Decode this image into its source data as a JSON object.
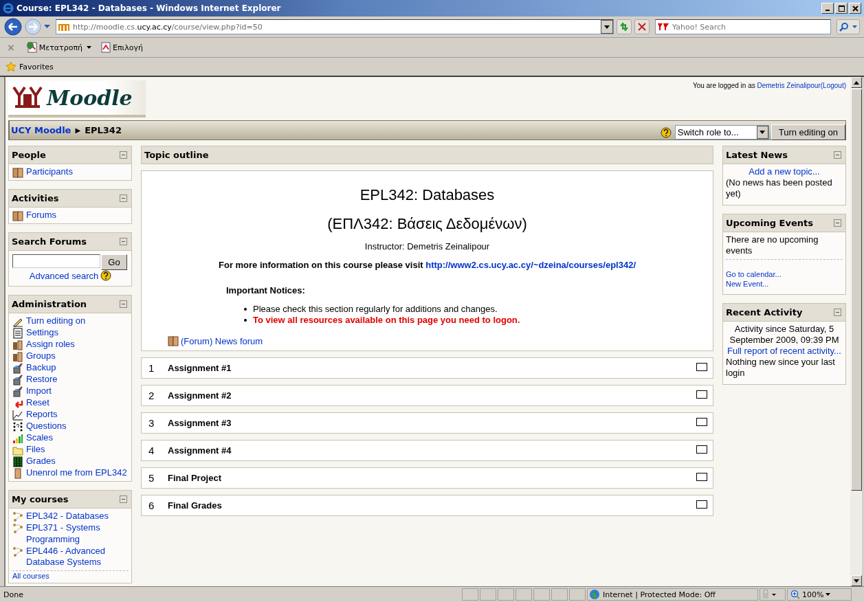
{
  "window": {
    "title": "Course: EPL342 - Databases - Windows Internet Explorer"
  },
  "address_bar": {
    "url_prefix": "http://moodle.cs.",
    "url_domain": "ucy.ac.cy",
    "url_path": "/course/view.php?id=50",
    "search_placeholder": "Yahoo! Search"
  },
  "command_bar": {
    "close": "×",
    "items": [
      "Μετατροπή",
      "Επιλογή"
    ]
  },
  "favorites": {
    "label": "Favorites"
  },
  "header": {
    "logo": "Moodle",
    "login_prefix": "You are logged in as",
    "user": "Demetris Zeinalipour",
    "logout": "(Logout)"
  },
  "breadcrumb": {
    "items": [
      "UCY Moodle",
      "EPL342"
    ],
    "separator": "▶"
  },
  "role_select": {
    "value": "Switch role to..."
  },
  "edit_button": {
    "label": "Turn editing on"
  },
  "left_blocks": [
    {
      "title": "People",
      "kind": "links",
      "items": [
        "Participants"
      ]
    },
    {
      "title": "Activities",
      "kind": "links",
      "items": [
        "Forums"
      ]
    },
    {
      "title": "Search Forums",
      "kind": "search",
      "button": "Go",
      "link": "Advanced search"
    },
    {
      "title": "Administration",
      "kind": "admin",
      "items": [
        "Turn editing on",
        "Settings",
        "Assign roles",
        "Groups",
        "Backup",
        "Restore",
        "Import",
        "Reset",
        "Reports",
        "Questions",
        "Scales",
        "Files",
        "Grades",
        "Unenrol me from EPL342"
      ]
    },
    {
      "title": "My courses",
      "kind": "courses",
      "items": [
        "EPL342 - Databases",
        "EPL371 - Systems Programming",
        "EPL446 - Advanced Database Systems"
      ],
      "footer": "All courses"
    }
  ],
  "topic_outline": {
    "title": "Topic outline",
    "course_title": "EPL342: Databases",
    "course_subtitle": "(ΕΠΛ342: Βάσεις Δεδομένων)",
    "instructor": "Instructor: Demetris Zeinalipour",
    "info": "For more information on this course please visit",
    "info_link": "http://www2.cs.ucy.ac.cy/~dzeina/courses/epl342/",
    "notices_title": "Important Notices:",
    "notices": [
      {
        "text": "Please check this section regularly for additions and changes.",
        "kind": "normal"
      },
      {
        "text": "To view all resources available on this page you need to logon.",
        "kind": "alert"
      }
    ],
    "forum": "(Forum) News forum",
    "sections": [
      {
        "number": "1",
        "title": "Assignment #1"
      },
      {
        "number": "2",
        "title": "Assignment #2"
      },
      {
        "number": "3",
        "title": "Assignment #3"
      },
      {
        "number": "4",
        "title": "Assignment #4"
      },
      {
        "number": "5",
        "title": "Final Project"
      },
      {
        "number": "6",
        "title": "Final Grades"
      }
    ]
  },
  "right_blocks": [
    {
      "title": "Latest News",
      "lines": [
        {
          "kind": "link-center",
          "text": "Add a new topic..."
        },
        {
          "kind": "text",
          "text": "(No news has been posted yet)"
        }
      ]
    },
    {
      "title": "Upcoming Events",
      "lines": [
        {
          "kind": "text",
          "text": "There are no upcoming events"
        },
        {
          "kind": "rule"
        },
        {
          "kind": "small-link",
          "text": "Go to calendar..."
        },
        {
          "kind": "small-link",
          "text": "New Event..."
        }
      ]
    },
    {
      "title": "Recent Activity",
      "lines": [
        {
          "kind": "text-center",
          "text": "Activity since Saturday, 5 September 2009, 09:39 PM"
        },
        {
          "kind": "link-center",
          "text": "Full report of recent activity..."
        },
        {
          "kind": "text",
          "text": "Nothing new since your last login"
        }
      ]
    }
  ],
  "status_bar": {
    "text": "Done",
    "zone": "Internet | Protected Mode: Off",
    "zoom": "100%"
  }
}
